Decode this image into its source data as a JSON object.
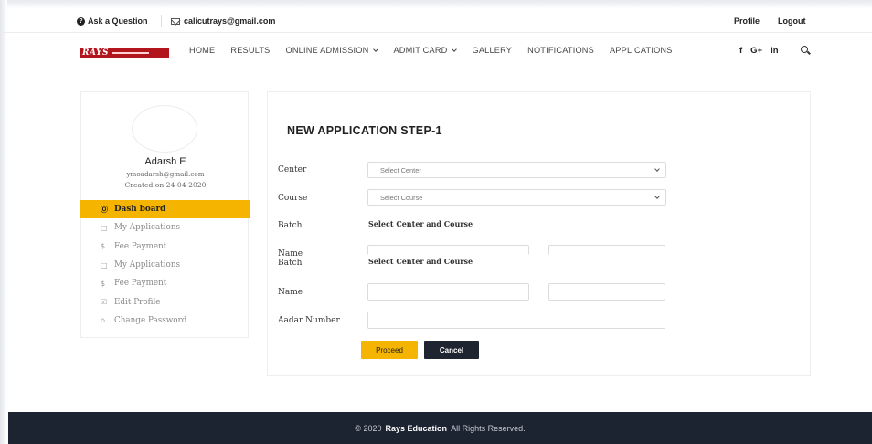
{
  "topbar": {
    "ask": "Ask a Question",
    "email": "calicutrays@gmail.com",
    "profile": "Profile",
    "logout": "Logout"
  },
  "logo": {
    "text": "RAYS"
  },
  "nav": {
    "items": [
      "HOME",
      "RESULTS",
      "ONLINE ADMISSION",
      "ADMIT CARD",
      "GALLERY",
      "NOTIFICATIONS",
      "APPLICATIONS"
    ],
    "social": [
      "f",
      "G+",
      "in"
    ]
  },
  "user": {
    "name": "Adarsh E",
    "email": "ymoadarsh@gmail.com",
    "created": "Created on  24-04-2020"
  },
  "sidebar": {
    "items": [
      {
        "label": "Dash board",
        "icon": "dashboard-icon",
        "glyph": "Ⓞ"
      },
      {
        "label": "My Applications",
        "icon": "book-icon",
        "glyph": "□"
      },
      {
        "label": "Fee Payment",
        "icon": "dollar-icon",
        "glyph": "$"
      },
      {
        "label": "My Applications",
        "icon": "book-icon",
        "glyph": "□"
      },
      {
        "label": "Fee Payment",
        "icon": "dollar-icon",
        "glyph": "$"
      },
      {
        "label": "Edit Profile",
        "icon": "edit-icon",
        "glyph": "☑"
      },
      {
        "label": "Change Password",
        "icon": "lock-icon",
        "glyph": "⌂"
      }
    ]
  },
  "form": {
    "title": "NEW APPLICATION STEP-1",
    "center_label": "Center",
    "center_value": "Select Center",
    "course_label": "Course",
    "course_value": "Select Course",
    "batch_label": "Batch",
    "batch_text": "Select Center and Course",
    "name_label_clipped": "Name",
    "batch_label_2": "Batch",
    "batch_text_2": "Select Center and Course",
    "name_label": "Name",
    "aadar_label": "Aadar Number",
    "proceed": "Proceed",
    "cancel": "Cancel"
  },
  "footer": {
    "prefix": "© 2020",
    "brand": "Rays Education",
    "suffix": "All Rights Reserved."
  },
  "colors": {
    "accent": "#f4b400",
    "dark": "#1d2431",
    "logo_red": "#b3151d"
  }
}
